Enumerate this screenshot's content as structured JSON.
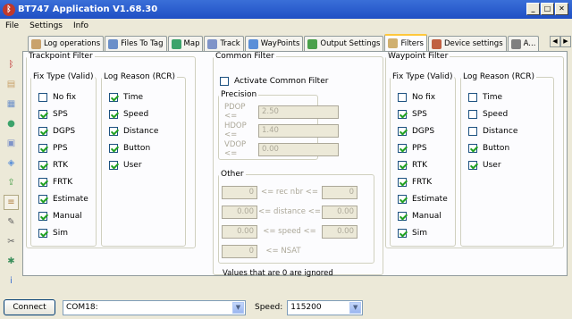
{
  "window": {
    "title": "BT747 Application V1.68.30"
  },
  "menu": [
    "File",
    "Settings",
    "Info"
  ],
  "tabs": [
    {
      "label": "Log operations",
      "icon": "document-icon",
      "color": "#c9a26c"
    },
    {
      "label": "Files To Tag",
      "icon": "table-icon",
      "color": "#6b8fc9"
    },
    {
      "label": "Map",
      "icon": "globe-icon",
      "color": "#3ca36b"
    },
    {
      "label": "Track",
      "icon": "track-icon",
      "color": "#7f94c8"
    },
    {
      "label": "WayPoints",
      "icon": "waypoints-icon",
      "color": "#5a8fd8"
    },
    {
      "label": "Output Settings",
      "icon": "output-icon",
      "color": "#4aa04a"
    },
    {
      "label": "Filters",
      "icon": "filter-icon",
      "color": "#d0b070"
    },
    {
      "label": "Device settings",
      "icon": "device-icon",
      "color": "#c06040"
    },
    {
      "label": "A...",
      "icon": "wrench-icon",
      "color": "#808080"
    }
  ],
  "active_tab": "Filters",
  "trackpoint": {
    "title": "Trackpoint Filter",
    "fix_title": "Fix Type (Valid)",
    "fix": [
      {
        "label": "No fix",
        "checked": false
      },
      {
        "label": "SPS",
        "checked": true
      },
      {
        "label": "DGPS",
        "checked": true
      },
      {
        "label": "PPS",
        "checked": true
      },
      {
        "label": "RTK",
        "checked": true
      },
      {
        "label": "FRTK",
        "checked": true
      },
      {
        "label": "Estimate",
        "checked": true
      },
      {
        "label": "Manual",
        "checked": true
      },
      {
        "label": "Sim",
        "checked": true
      }
    ],
    "reason_title": "Log Reason (RCR)",
    "reason": [
      {
        "label": "Time",
        "checked": true
      },
      {
        "label": "Speed",
        "checked": true
      },
      {
        "label": "Distance",
        "checked": true
      },
      {
        "label": "Button",
        "checked": true
      },
      {
        "label": "User",
        "checked": true
      }
    ]
  },
  "common": {
    "title": "Common Filter",
    "activate_label": "Activate Common Filter",
    "activate_checked": false,
    "precision_title": "Precision",
    "pdop_label": "PDOP <=",
    "pdop": "2.50",
    "hdop_label": "HDOP <=",
    "hdop": "1.40",
    "vdop_label": "VDOP <=",
    "vdop": "0.00",
    "other_title": "Other",
    "rec_min": "0",
    "rec_label": "<= rec nbr <=",
    "rec_max": "0",
    "dist_min": "0.00",
    "dist_label": "<= distance <=",
    "dist_max": "0.00",
    "speed_min": "0.00",
    "speed_label": "<= speed <=",
    "speed_max": "0.00",
    "nsat": "0",
    "nsat_label": "<= NSAT",
    "note": "Values that are 0 are ignored"
  },
  "waypoint": {
    "title": "Waypoint Filter",
    "fix_title": "Fix Type (Valid)",
    "fix": [
      {
        "label": "No fix",
        "checked": false
      },
      {
        "label": "SPS",
        "checked": true
      },
      {
        "label": "DGPS",
        "checked": true
      },
      {
        "label": "PPS",
        "checked": true
      },
      {
        "label": "RTK",
        "checked": true
      },
      {
        "label": "FRTK",
        "checked": true
      },
      {
        "label": "Estimate",
        "checked": true
      },
      {
        "label": "Manual",
        "checked": true
      },
      {
        "label": "Sim",
        "checked": true
      }
    ],
    "reason_title": "Log Reason (RCR)",
    "reason": [
      {
        "label": "Time",
        "checked": false
      },
      {
        "label": "Speed",
        "checked": false
      },
      {
        "label": "Distance",
        "checked": false
      },
      {
        "label": "Button",
        "checked": true
      },
      {
        "label": "User",
        "checked": true
      }
    ]
  },
  "sidebar_icons": [
    {
      "name": "bluetooth-icon",
      "glyph": "ᛒ",
      "color": "#c03030"
    },
    {
      "name": "document-icon",
      "glyph": "▤",
      "color": "#c9a26c"
    },
    {
      "name": "table-icon",
      "glyph": "▦",
      "color": "#6b8fc9"
    },
    {
      "name": "globe-icon",
      "glyph": "●",
      "color": "#3ca36b"
    },
    {
      "name": "track-icon",
      "glyph": "▣",
      "color": "#7f94c8"
    },
    {
      "name": "waypoints-icon",
      "glyph": "◈",
      "color": "#5a8fd8"
    },
    {
      "name": "output-icon",
      "glyph": "⇪",
      "color": "#4aa04a"
    },
    {
      "name": "filter-icon",
      "glyph": "≡",
      "color": "#b08040"
    },
    {
      "name": "wrench-icon",
      "glyph": "✎",
      "color": "#606060"
    },
    {
      "name": "tools-icon",
      "glyph": "✂",
      "color": "#606060"
    },
    {
      "name": "settings-icon",
      "glyph": "✱",
      "color": "#3c8f5c"
    },
    {
      "name": "info-icon",
      "glyph": "i",
      "color": "#3b6fd0"
    }
  ],
  "bottom": {
    "connect_label": "Connect",
    "port": "COM18:",
    "speed_label": "Speed:",
    "speed": "115200"
  }
}
